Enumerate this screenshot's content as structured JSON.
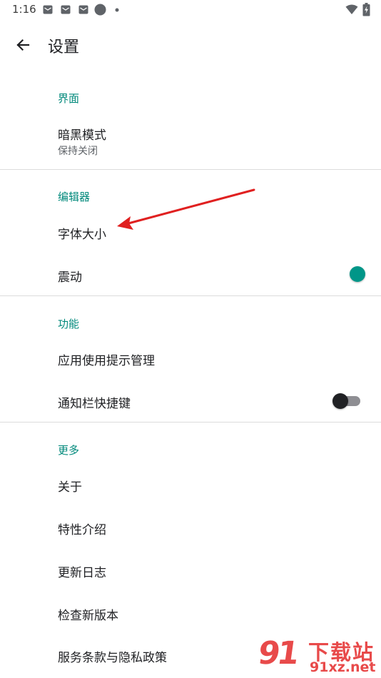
{
  "status_bar": {
    "time": "1:16",
    "icons": [
      "mail-icon",
      "mail-icon",
      "mail-icon",
      "circle-icon",
      "dot-icon",
      "wifi-icon",
      "battery-charging-icon"
    ]
  },
  "toolbar": {
    "back_icon": "arrow-left-icon",
    "title": "设置"
  },
  "sections": [
    {
      "header": "界面",
      "items": [
        {
          "title": "暗黑模式",
          "summary": "保持关闭"
        }
      ]
    },
    {
      "header": "编辑器",
      "items": [
        {
          "title": "字体大小"
        },
        {
          "title": "震动",
          "toggle": true
        }
      ]
    },
    {
      "header": "功能",
      "items": [
        {
          "title": "应用使用提示管理"
        },
        {
          "title": "通知栏快捷键",
          "toggle": false
        }
      ]
    },
    {
      "header": "更多",
      "items": [
        {
          "title": "关于"
        },
        {
          "title": "特性介绍"
        },
        {
          "title": "更新日志"
        },
        {
          "title": "检查新版本"
        },
        {
          "title": "服务条款与隐私政策"
        }
      ]
    }
  ],
  "colors": {
    "accent": "#00897b",
    "switch_on": "#009688",
    "annotation": "#e02020",
    "watermark": "#e84a4a"
  },
  "watermark": {
    "mark": "91",
    "brand": "下载站",
    "domain": "91xz.net"
  }
}
